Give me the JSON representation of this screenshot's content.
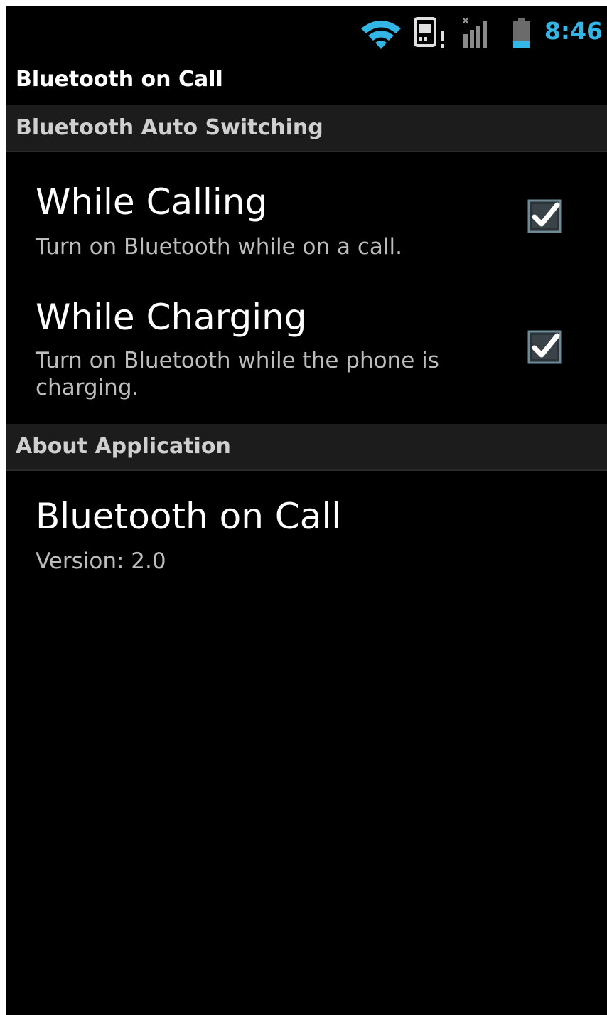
{
  "status_bar": {
    "time": "8:46",
    "icons": [
      "wifi-icon",
      "sim-alert-icon",
      "signal-icon",
      "battery-icon"
    ],
    "accent_color": "#33b5e5"
  },
  "app_title": "Bluetooth on Call",
  "sections": {
    "auto_switching": {
      "header": "Bluetooth Auto Switching",
      "items": [
        {
          "title": "While Calling",
          "summary": "Turn on Bluetooth while on a call.",
          "checked": true
        },
        {
          "title": "While Charging",
          "summary": "Turn on Bluetooth while the phone is charging.",
          "checked": true
        }
      ]
    },
    "about": {
      "header": "About Application",
      "item": {
        "title": "Bluetooth on Call",
        "summary": "Version: 2.0"
      }
    }
  }
}
